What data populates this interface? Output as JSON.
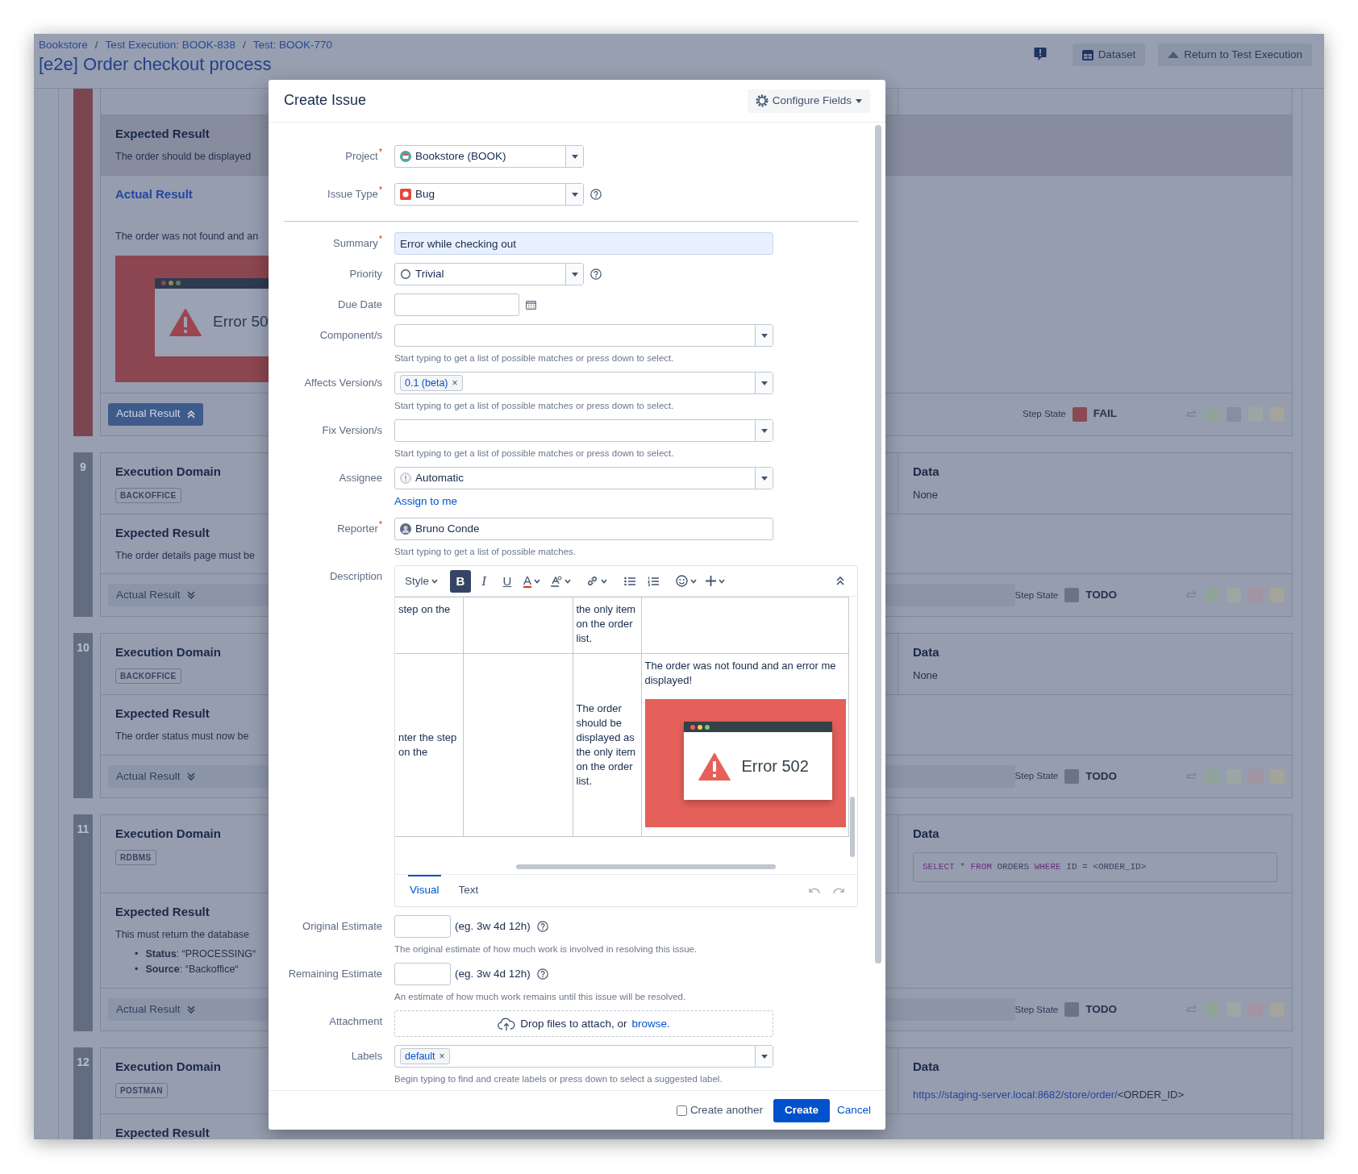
{
  "header": {
    "breadcrumbs": [
      {
        "label": "Bookstore",
        "separator": "/"
      },
      {
        "label": "Test Execution: BOOK-838",
        "separator": "/"
      },
      {
        "label": "Test: BOOK-770"
      }
    ],
    "title": "[e2e] Order checkout process",
    "actions": [
      {
        "kind": "dataset",
        "label": "Dataset"
      },
      {
        "kind": "return",
        "label": "Return to Test Execution"
      }
    ]
  },
  "steps": [
    {
      "color": "#7b4650",
      "expected": {
        "heading": "Expected Result",
        "text": "The order should be displayed",
        "highlighted": true
      },
      "actual": {
        "heading": "Actual Result",
        "text": "The order was not found and an",
        "image": {
          "caption": "Error 50"
        }
      },
      "footer": {
        "actual_button": {
          "label": "Actual Result",
          "expanded": true
        },
        "state_label": "Step State",
        "state": {
          "label": "FAIL",
          "color": "#8b4a53"
        },
        "state_buttons": [
          {
            "color": "#8fa39a"
          },
          {
            "color": "#858ea2"
          },
          {
            "color": "#9ba7a2"
          },
          {
            "color": "#a4a49a"
          }
        ]
      }
    },
    {
      "number": "9",
      "color": "#636d82",
      "domain": {
        "heading": "Execution Domain",
        "badge": "BACKOFFICE"
      },
      "data": {
        "heading": "Data",
        "text": "None"
      },
      "expected": {
        "heading": "Expected Result",
        "text": "The order details page must be",
        "highlighted": false
      },
      "footer": {
        "actual_button": {
          "label": "Actual Result",
          "expanded": false
        },
        "state_label": "Step State",
        "state": {
          "label": "TODO",
          "color": "#6b7388"
        },
        "state_buttons": [
          {
            "color": "#8fa39a"
          },
          {
            "color": "#9ba7a2"
          },
          {
            "color": "#a394a2"
          },
          {
            "color": "#a4a49a"
          }
        ]
      }
    },
    {
      "number": "10",
      "color": "#636d82",
      "domain": {
        "heading": "Execution Domain",
        "badge": "BACKOFFICE"
      },
      "data": {
        "heading": "Data",
        "text": "None"
      },
      "expected": {
        "heading": "Expected Result",
        "text": "The order status must now be",
        "highlighted": false
      },
      "footer": {
        "actual_button": {
          "label": "Actual Result",
          "expanded": false
        },
        "state_label": "Step State",
        "state": {
          "label": "TODO",
          "color": "#6b7388"
        },
        "state_buttons": [
          {
            "color": "#8fa39a"
          },
          {
            "color": "#9ba7a2"
          },
          {
            "color": "#a394a2"
          },
          {
            "color": "#a4a49a"
          }
        ]
      }
    },
    {
      "number": "11",
      "color": "#636d82",
      "domain": {
        "heading": "Execution Domain",
        "badge": "RDBMS"
      },
      "data": {
        "heading": "Data",
        "code": [
          {
            "kind": "keyword",
            "text": "SELECT"
          },
          {
            "kind": "plain",
            "text": "*"
          },
          {
            "kind": "keyword",
            "text": "FROM"
          },
          {
            "kind": "plain",
            "text": "ORDERS"
          },
          {
            "kind": "keyword",
            "text": "WHERE"
          },
          {
            "kind": "plain",
            "text": "ID = <ORDER_ID>"
          }
        ]
      },
      "expected": {
        "heading": "Expected Result",
        "text": "This must return the database",
        "bullets": [
          {
            "marker": "•",
            "text": "**Status**: “PROCESSING“"
          },
          {
            "marker": "•",
            "text": "**Source**: “Backoffice“"
          }
        ],
        "highlighted": false
      },
      "footer": {
        "actual_button": {
          "label": "Actual Result",
          "expanded": false
        },
        "state_label": "Step State",
        "state": {
          "label": "TODO",
          "color": "#6b7388"
        },
        "state_buttons": [
          {
            "color": "#8fa39a"
          },
          {
            "color": "#9ba7a2"
          },
          {
            "color": "#a394a2"
          },
          {
            "color": "#a4a49a"
          }
        ]
      }
    },
    {
      "number": "12",
      "color": "#636d82",
      "domain": {
        "heading": "Execution Domain",
        "badge": "POSTMAN"
      },
      "data": {
        "heading": "Data",
        "link": "https://staging-server.local:8682/store/order/",
        "text": "<ORDER_ID>"
      },
      "expected": {
        "heading": "Expected Result",
        "highlighted": false
      }
    }
  ],
  "dialog": {
    "title": "Create Issue",
    "configure": "Configure Fields",
    "fields": [
      {
        "kind": "select",
        "label": "Project",
        "required_mark": "*",
        "value": "Bookstore (BOOK)"
      },
      {
        "kind": "select",
        "label": "Issue Type",
        "required_mark": "*",
        "value": "Bug",
        "help": true,
        "divider_after": true
      },
      {
        "kind": "text",
        "label": "Summary",
        "required_mark": "*",
        "value": "Error while checking out"
      },
      {
        "kind": "select",
        "label": "Priority",
        "value": "Trivial",
        "help": true
      },
      {
        "kind": "date",
        "label": "Due Date"
      },
      {
        "kind": "multiselect",
        "label": "Component/s",
        "hint": "Start typing to get a list of possible matches or press down to select."
      },
      {
        "kind": "multiselect",
        "label": "Affects Version/s",
        "tags": [
          {
            "label": "0.1 (beta)",
            "remove": "×"
          }
        ],
        "hint": "Start typing to get a list of possible matches or press down to select."
      },
      {
        "kind": "multiselect",
        "label": "Fix Version/s",
        "hint": "Start typing to get a list of possible matches or press down to select."
      },
      {
        "kind": "picker",
        "label": "Assignee",
        "value": "Automatic",
        "link": "Assign to me"
      },
      {
        "kind": "user",
        "label": "Reporter",
        "required_mark": "*",
        "value": "Bruno Conde",
        "hint": "Start typing to get a list of possible matches."
      },
      {
        "kind": "editor",
        "label": "Description",
        "toolbar": [
          {
            "kind": "style",
            "label": "Style"
          },
          {
            "kind": "bold",
            "glyph": "B",
            "selected": true
          },
          {
            "kind": "italic",
            "glyph": "I",
            "selected": false
          },
          {
            "kind": "underline",
            "glyph": "U",
            "selected": false
          },
          {
            "kind": "color",
            "glyph": "A"
          },
          {
            "kind": "format"
          },
          {
            "kind": "link"
          },
          {
            "kind": "bullets"
          },
          {
            "kind": "numbers"
          },
          {
            "kind": "emoji"
          },
          {
            "kind": "insert"
          },
          {
            "kind": "collapse"
          }
        ],
        "table": {
          "rows": [
            {
              "cells": [
                {
                  "text": "step on the"
                },
                {},
                {
                  "text": "the only item on the order list."
                },
                {}
              ]
            },
            {
              "cells": [
                {
                  "text": "nter the step on the"
                },
                {},
                {
                  "text": "The order should be displayed as the only item on the order list."
                },
                {
                  "lines": [
                    "The order was not found and an error me",
                    "displayed!"
                  ],
                  "image": {
                    "caption": "Error 502"
                  }
                }
              ]
            }
          ]
        },
        "tabs": [
          {
            "label": "Visual",
            "selected": true
          },
          {
            "label": "Text",
            "selected": false
          }
        ]
      },
      {
        "kind": "estimate",
        "label": "Original Estimate",
        "example": "(eg. 3w 4d 12h)",
        "help": true,
        "hint": "The original estimate of how much work is involved in resolving this issue."
      },
      {
        "kind": "estimate",
        "label": "Remaining Estimate",
        "example": "(eg. 3w 4d 12h)",
        "help": true,
        "hint": "An estimate of how much work remains until this issue will be resolved."
      },
      {
        "kind": "attachment",
        "label": "Attachment",
        "text": "Drop files to attach, or",
        "link": "browse."
      },
      {
        "kind": "multiselect",
        "label": "Labels",
        "tags": [
          {
            "label": "default",
            "remove": "×"
          }
        ],
        "hint": "Begin typing to find and create labels or press down to select a suggested label."
      }
    ],
    "footer": {
      "create_another": {
        "label": "Create another",
        "checked": false
      },
      "create": "Create",
      "cancel": "Cancel"
    }
  }
}
